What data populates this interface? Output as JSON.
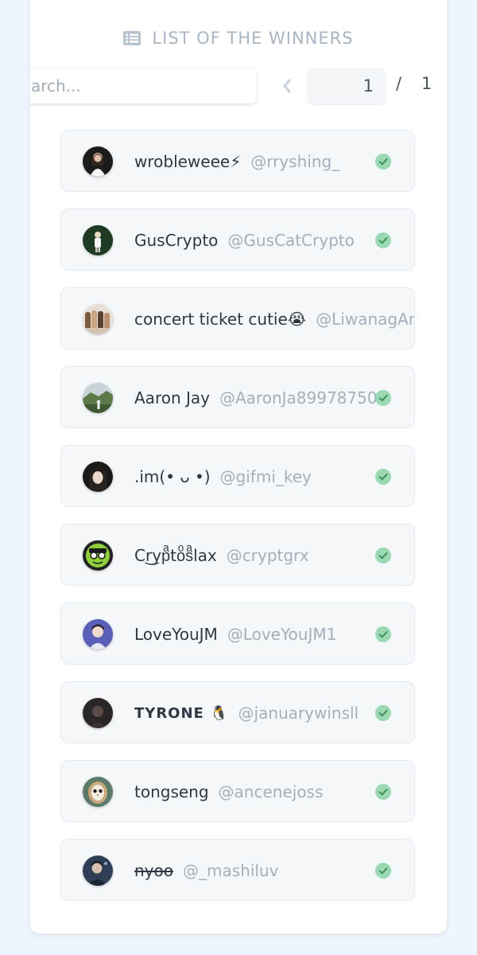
{
  "header": {
    "title": "LIST OF THE WINNERS",
    "icon": "list-icon"
  },
  "search": {
    "placeholder": "Search...",
    "value": ""
  },
  "pagination": {
    "current_page": "1",
    "separator": "/",
    "total_pages": "1"
  },
  "colors": {
    "background": "#eef5fc",
    "card": "#ffffff",
    "row": "#f5f8fb",
    "check": "#7ccf99",
    "muted_text": "#a4afba"
  },
  "winners": [
    {
      "name": "wrobleweee⚡",
      "handle": "@rryshing_",
      "verified": true
    },
    {
      "name": "GusCrypto",
      "handle": "@GusCatCrypto",
      "verified": true
    },
    {
      "name": "concert ticket cutie😭",
      "handle": "@LiwanagAr",
      "verified": true
    },
    {
      "name": "Aaron Jay",
      "handle": "@AaronJa89978750",
      "verified": true
    },
    {
      "name": ".im(• ᴗ •)",
      "handle": "@gifmi_key",
      "verified": true
    },
    {
      "name": "Cr͜ypͣtoͦsͣlax",
      "handle": "@cryptgrx",
      "verified": true
    },
    {
      "name": "LoveYouJM",
      "handle": "@LoveYouJM1",
      "verified": true
    },
    {
      "name": "TYRONE 🐧",
      "handle": "@januarywinsll",
      "verified": true
    },
    {
      "name": "tongseng",
      "handle": "@ancenejoss",
      "verified": true
    },
    {
      "name": "nyoo",
      "handle": "@_mashiluv",
      "verified": true
    }
  ]
}
